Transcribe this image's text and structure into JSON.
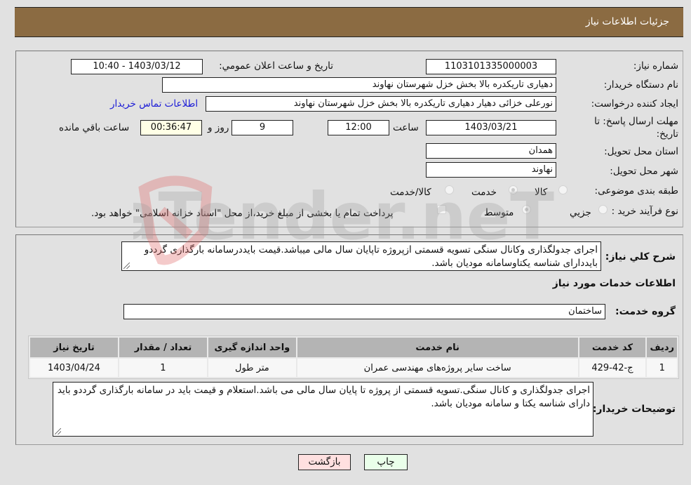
{
  "header": {
    "title": "جزئیات اطلاعات نیاز"
  },
  "info": {
    "need_number_label": "شماره نیاز:",
    "need_number": "1103101335000003",
    "announce_label": "تاریخ و ساعت اعلان عمومي:",
    "announce_value": "1403/03/12 - 10:40",
    "buyer_org_label": "نام دستگاه خریدار:",
    "buyer_org": "دهیاری تاریکدره بالا بخش خزل شهرستان نهاوند",
    "creator_label": "ایجاد کننده درخواست:",
    "creator": "نورعلی خزائی دهیار دهیاری تاریکدره بالا بخش خزل شهرستان نهاوند",
    "contact_link": "اطلاعات تماس خریدار",
    "deadline_label_line1": "مهلت ارسال پاسخ: تا",
    "deadline_label_line2": "تاریخ:",
    "deadline_date": "1403/03/21",
    "time_label": "ساعت",
    "deadline_time": "12:00",
    "days_value": "9",
    "days_label": "روز و",
    "remaining_time": "00:36:47",
    "remaining_label": "ساعت باقي مانده",
    "province_label": "استان محل تحویل:",
    "province": "همدان",
    "city_label": "شهر محل تحویل:",
    "city": "نهاوند",
    "category_label": "طبقه بندی موضوعی:",
    "category_options": [
      {
        "label": "کالا",
        "checked": false
      },
      {
        "label": "خدمت",
        "checked": true
      },
      {
        "label": "کالا/خدمت",
        "checked": false
      }
    ],
    "process_label": "نوع فرآیند خرید :",
    "process_options": [
      {
        "label": "جزيي",
        "checked": false
      },
      {
        "label": "متوسط",
        "checked": true
      }
    ],
    "treasury_note": "پرداخت تمام یا بخشی از مبلغ خرید،از محل \"اسناد خزانه اسلامی\" خواهد بود."
  },
  "description": {
    "label": "شرح کلي نیاز:",
    "text": "اجرای جدولگذاری وکانال سنگی تسویه قسمتی ازپروژه تاپایان سال مالی میباشد.قیمت بایددرسامانه بارگذاری گرددو بایددارای شناسه یکتاوسامانه مودیان باشد."
  },
  "services": {
    "section_title": "اطلاعات خدمات مورد نیاز",
    "group_label": "گروه خدمت:",
    "group_value": "ساختمان",
    "columns": [
      "ردیف",
      "کد خدمت",
      "نام خدمت",
      "واحد اندازه گیری",
      "تعداد / مقدار",
      "تاریخ نیاز"
    ],
    "rows": [
      [
        "1",
        "ج-42-429",
        "ساخت سایر پروژه‌های مهندسی عمران",
        "متر طول",
        "1",
        "1403/04/24"
      ]
    ]
  },
  "buyer_notes": {
    "label": "توضیحات خریدار:",
    "text": "اجرای جدولگذاری و کانال سنگی.تسویه قسمتی از پروژه تا پایان سال مالی می باشد.استعلام و قیمت باید در سامانه بارگذاری گرددو باید دارای شناسه یکتا و سامانه مودیان باشد."
  },
  "buttons": {
    "print": "چاپ",
    "back": "بازگشت"
  },
  "watermark": {
    "text": "AriaTender.neT"
  }
}
